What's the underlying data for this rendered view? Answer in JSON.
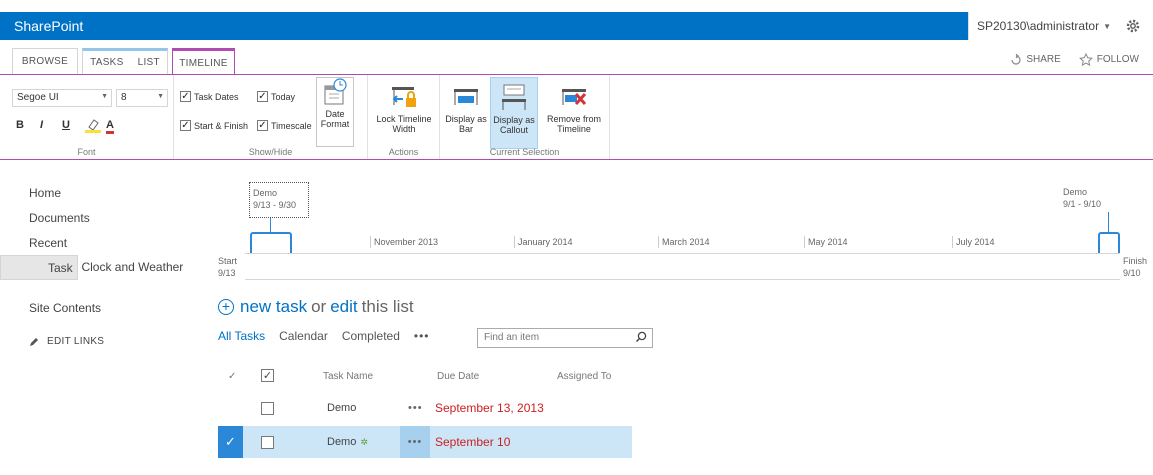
{
  "suitebar": {
    "brand": "SharePoint",
    "user": "SP20130\\administrator",
    "bar_color": "#0072c6"
  },
  "tabs": {
    "browse": "BROWSE",
    "tasks": "TASKS",
    "list": "LIST",
    "timeline": "TIMELINE",
    "share": "SHARE",
    "follow": "FOLLOW"
  },
  "ribbon": {
    "font": {
      "family": "Segoe UI",
      "size": "8",
      "bold": "B",
      "italic": "I",
      "underline": "U",
      "color": "A",
      "label": "Font"
    },
    "show_hide": {
      "task_dates": "Task Dates",
      "today": "Today",
      "start_finish": "Start & Finish",
      "timescale": "Timescale",
      "date_format": "Date Format",
      "label": "Show/Hide"
    },
    "actions": {
      "lock_width": "Lock Timeline Width",
      "label": "Actions"
    },
    "current_selection": {
      "display_bar": "Display as Bar",
      "display_callout": "Display as Callout",
      "remove": "Remove from Timeline",
      "label": "Current Selection"
    }
  },
  "nav": {
    "items": [
      "Home",
      "Documents",
      "Recent"
    ],
    "recent_items": [
      "Task"
    ],
    "world_clock": "World Clock and Weather",
    "site_contents": "Site Contents",
    "edit_links": "EDIT LINKS"
  },
  "timeline": {
    "callout_left": {
      "title": "Demo",
      "dates": "9/13 - 9/30"
    },
    "callout_right": {
      "title": "Demo",
      "dates": "9/1 - 9/10"
    },
    "months": [
      "November 2013",
      "January 2014",
      "March 2014",
      "May 2014",
      "July 2014"
    ],
    "start_label": "Start",
    "start_date": "9/13",
    "finish_label": "Finish",
    "finish_date": "9/10"
  },
  "list": {
    "new_task": "new task",
    "or": "or",
    "edit": "edit",
    "this_list": "this list",
    "views": [
      "All Tasks",
      "Calendar",
      "Completed"
    ],
    "more": "•••",
    "search_placeholder": "Find an item",
    "headers": {
      "task_name": "Task Name",
      "due_date": "Due Date",
      "assigned_to": "Assigned To"
    },
    "rows": [
      {
        "name": "Demo",
        "due": "September 13, 2013",
        "dots": "•••"
      },
      {
        "name": "Demo",
        "due": "September 10",
        "dots": "•••"
      }
    ]
  }
}
